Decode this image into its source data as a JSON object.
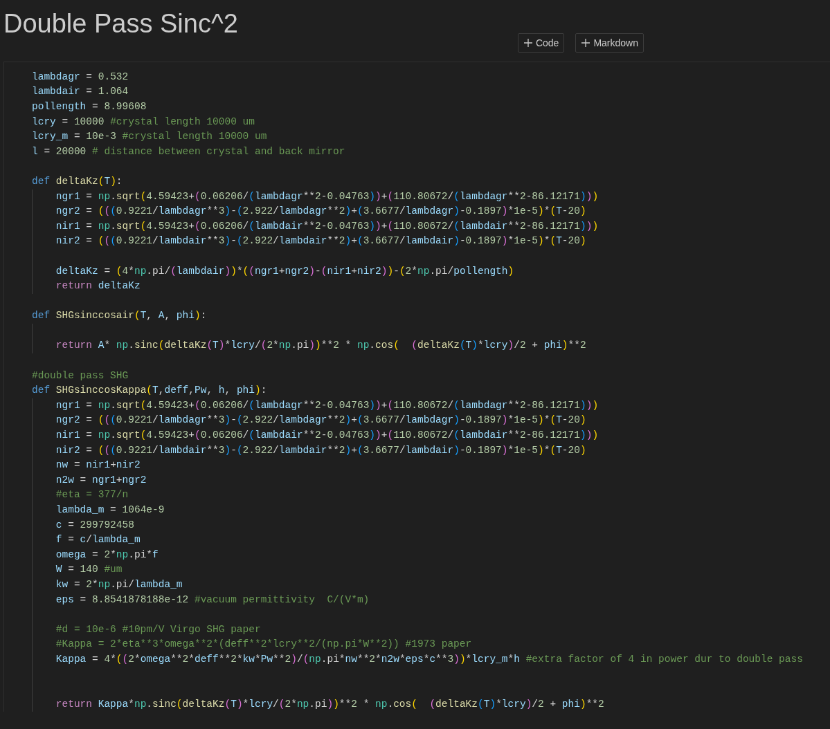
{
  "title": "Double Pass Sinc^2",
  "toolbar": [
    {
      "kind": "add",
      "label": "Code"
    },
    {
      "kind": "add",
      "label": "Markdown"
    }
  ],
  "cell": {
    "lines": [
      {
        "kind": "code",
        "text": "lambdagr = 0.532"
      },
      {
        "kind": "code",
        "text": "lambdair = 1.064"
      },
      {
        "kind": "code",
        "text": "pollength = 8.99608"
      },
      {
        "kind": "code",
        "text": "lcry = 10000 #crystal length 10000 um"
      },
      {
        "kind": "code",
        "text": "lcry_m = 10e-3 #crystal length 10000 um"
      },
      {
        "kind": "code",
        "text": "l = 20000 # distance between crystal and back mirror"
      },
      {
        "kind": "blank"
      },
      {
        "kind": "code",
        "text": "def deltaKz(T):"
      },
      {
        "kind": "code",
        "text": "    ngr1 = np.sqrt(4.59423+(0.06206/(lambdagr**2-0.04763))+(110.80672/(lambdagr**2-86.12171)))"
      },
      {
        "kind": "code",
        "text": "    ngr2 = (((0.9221/lambdagr**3)-(2.922/lambdagr**2)+(3.6677/lambdagr)-0.1897)*1e-5)*(T-20)"
      },
      {
        "kind": "code",
        "text": "    nir1 = np.sqrt(4.59423+(0.06206/(lambdair**2-0.04763))+(110.80672/(lambdair**2-86.12171)))"
      },
      {
        "kind": "code",
        "text": "    nir2 = (((0.9221/lambdair**3)-(2.922/lambdair**2)+(3.6677/lambdair)-0.1897)*1e-5)*(T-20)"
      },
      {
        "kind": "blank"
      },
      {
        "kind": "code",
        "text": "    deltaKz = (4*np.pi/(lambdair))*((ngr1+ngr2)-(nir1+nir2))-(2*np.pi/pollength)"
      },
      {
        "kind": "code",
        "text": "    return deltaKz"
      },
      {
        "kind": "blank"
      },
      {
        "kind": "code",
        "text": "def SHGsinccosair(T, A, phi):"
      },
      {
        "kind": "blank"
      },
      {
        "kind": "code",
        "text": "    return A* np.sinc(deltaKz(T)*lcry/(2*np.pi))**2 * np.cos(  (deltaKz(T)*lcry)/2 + phi)**2"
      },
      {
        "kind": "blank"
      },
      {
        "kind": "code",
        "text": "#double pass SHG"
      },
      {
        "kind": "code",
        "text": "def SHGsinccosKappa(T,deff,Pw, h, phi):"
      },
      {
        "kind": "code",
        "text": "    ngr1 = np.sqrt(4.59423+(0.06206/(lambdagr**2-0.04763))+(110.80672/(lambdagr**2-86.12171)))"
      },
      {
        "kind": "code",
        "text": "    ngr2 = (((0.9221/lambdagr**3)-(2.922/lambdagr**2)+(3.6677/lambdagr)-0.1897)*1e-5)*(T-20)"
      },
      {
        "kind": "code",
        "text": "    nir1 = np.sqrt(4.59423+(0.06206/(lambdair**2-0.04763))+(110.80672/(lambdair**2-86.12171)))"
      },
      {
        "kind": "code",
        "text": "    nir2 = (((0.9221/lambdair**3)-(2.922/lambdair**2)+(3.6677/lambdair)-0.1897)*1e-5)*(T-20)"
      },
      {
        "kind": "code",
        "text": "    nw = nir1+nir2"
      },
      {
        "kind": "code",
        "text": "    n2w = ngr1+ngr2"
      },
      {
        "kind": "code",
        "text": "    #eta = 377/n"
      },
      {
        "kind": "code",
        "text": "    lambda_m = 1064e-9"
      },
      {
        "kind": "code",
        "text": "    c = 299792458"
      },
      {
        "kind": "code",
        "text": "    f = c/lambda_m"
      },
      {
        "kind": "code",
        "text": "    omega = 2*np.pi*f"
      },
      {
        "kind": "code",
        "text": "    W = 140 #um"
      },
      {
        "kind": "code",
        "text": "    kw = 2*np.pi/lambda_m"
      },
      {
        "kind": "code",
        "text": "    eps = 8.8541878188e-12 #vacuum permittivity  C/(V*m)"
      },
      {
        "kind": "blank"
      },
      {
        "kind": "code",
        "text": "    #d = 10e-6 #10pm/V Virgo SHG paper"
      },
      {
        "kind": "code",
        "text": "    #Kappa = 2*eta**3*omega**2*(deff**2*lcry**2/(np.pi*W**2)) #1973 paper"
      },
      {
        "kind": "code",
        "text": "    Kappa = 4*((2*omega**2*deff**2*kw*Pw**2)/(np.pi*nw**2*n2w*eps*c**3))*lcry_m*h #extra factor of 4 in power dur to double pass"
      },
      {
        "kind": "blank"
      },
      {
        "kind": "blank"
      },
      {
        "kind": "code",
        "text": "    return Kappa*np.sinc(deltaKz(T)*lcry/(2*np.pi))**2 * np.cos(  (deltaKz(T)*lcry)/2 + phi)**2"
      }
    ]
  }
}
